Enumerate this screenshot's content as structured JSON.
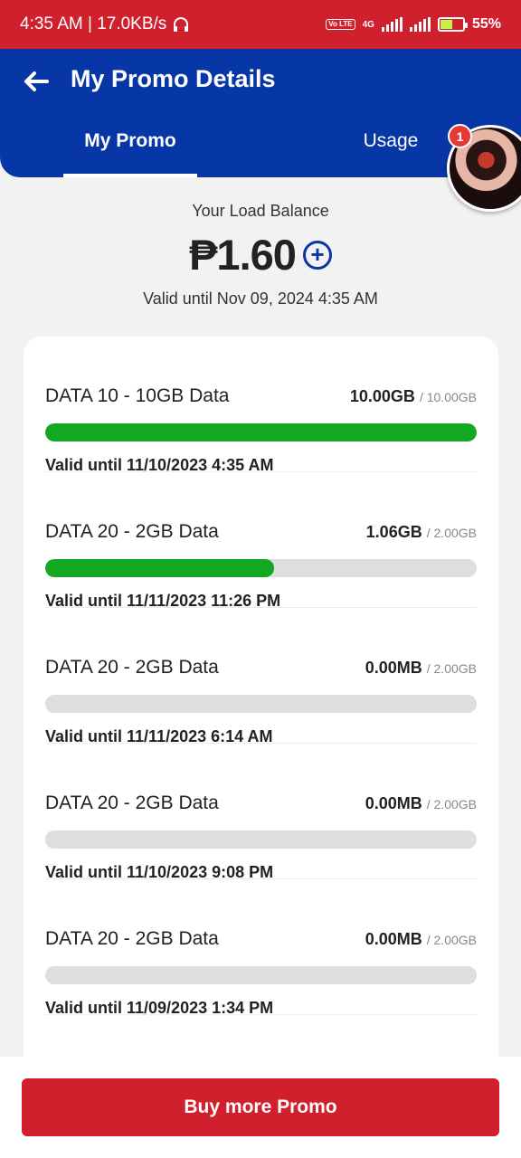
{
  "status_bar": {
    "time_speed": "4:35 AM | 17.0KB/s",
    "volte": "Vo LTE",
    "network": "4G",
    "battery": "55%"
  },
  "header": {
    "title": "My Promo Details",
    "tabs": [
      {
        "label": "My Promo",
        "active": true
      },
      {
        "label": "Usage",
        "active": false
      }
    ],
    "notification_count": "1"
  },
  "balance": {
    "label": "Your Load Balance",
    "amount": "₱1.60",
    "valid": "Valid until Nov 09, 2024 4:35 AM"
  },
  "promos": [
    {
      "name": "DATA 10 - 10GB Data",
      "used": "10.00GB",
      "total": "/ 10.00GB",
      "progress": 1.0,
      "valid": "Valid until 11/10/2023 4:35 AM"
    },
    {
      "name": "DATA 20 - 2GB Data",
      "used": "1.06GB",
      "total": "/ 2.00GB",
      "progress": 0.53,
      "valid": "Valid until 11/11/2023 11:26 PM"
    },
    {
      "name": "DATA 20 - 2GB Data",
      "used": "0.00MB",
      "total": "/ 2.00GB",
      "progress": 0,
      "valid": "Valid until 11/11/2023 6:14 AM"
    },
    {
      "name": "DATA 20 - 2GB Data",
      "used": "0.00MB",
      "total": "/ 2.00GB",
      "progress": 0,
      "valid": "Valid until 11/10/2023 9:08 PM"
    },
    {
      "name": "DATA 20 - 2GB Data",
      "used": "0.00MB",
      "total": "/ 2.00GB",
      "progress": 0,
      "valid": "Valid until 11/09/2023 1:34 PM"
    }
  ],
  "footer": {
    "buy_label": "Buy more Promo"
  },
  "colors": {
    "brand_blue": "#0736a6",
    "brand_red": "#d0202e",
    "progress_green": "#12a822"
  },
  "icons": {
    "back": "back-arrow-icon",
    "add": "plus-circle-icon",
    "headset": "headphones-icon"
  }
}
